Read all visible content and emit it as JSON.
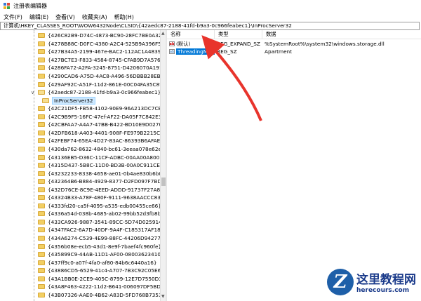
{
  "window": {
    "title": "注册表编辑器"
  },
  "menu": [
    "文件(F)",
    "编辑(E)",
    "查看(V)",
    "收藏夹(A)",
    "帮助(H)"
  ],
  "address": "计算机\\HKEY_CLASSES_ROOT\\WOW6432Node\\CLSID\\{42aedc87-2188-41fd-b9a3-0c966feabec1}\\InProcServer32",
  "tree": {
    "items_before": [
      "{426C82B9-D74C-4873-BC90-28FC7BE0A32A}",
      "{4278B88C-D0FC-4380-A2C4-525B9A396F5B}",
      "{427B34A5-2199-467e-BAC2-112AC1A48391}",
      "{427BC7E3-F833-4584-8745-CFAB9D7A5761}",
      "{4286FA72-A2FA-3245-8751-D4206070A191}",
      "{4290CAD6-A75D-4AC8-A496-56DBBB28EB88}",
      "{429AF92C-A51F-11d2-861E-00C04FA35C89}"
    ],
    "expanded": "{42aedc87-2188-41fd-b9a3-0c966feabec1}",
    "selected": "InProcServer32",
    "items_after": [
      "{42C21DF5-FB58-4102-90E9-96A213DC7CE8}",
      "{42C9B9F5-16FC-47ef-AF22-DA05F7C842E3}",
      "{42CBFAA7-A4A7-47BB-B422-BD10E9D02700}",
      "{42DFB618-A403-4401-908F-FE979B2215C8}",
      "{42FEBF74-65EA-4D27-83AC-86393B6AFAE1}",
      "{430da762-8632-4840-bc61-3eeaa078e62e}",
      "{43136EB5-D36C-11CF-ADBC-00AA00A80033}",
      "{4315D437-5B8C-11D0-BD3B-00A0C911CE86}",
      "{43232233-8338-4658-ae01-0b4ae830b6b0}",
      "{432364B6-B884-4929-8377-D2FD097F7BD3}",
      "{432D76CE-8C9E-4EED-ADDD-91737F27A8CB}",
      "{43324B33-A78F-480F-9111-9638AACCC832}",
      "{4333fd20-ca5f-4095-a535-edb00455ce66}",
      "{4336a54d-038b-4685-ab02-99bb52d3fb8b}",
      "{433CA926-9887-3541-89CC-5D74D0259144}",
      "{4347FAC2-6A7D-40DF-9A4F-C185317AF183}",
      "{434A6274-C539-4E99-88FC-44206D942775}",
      "{4356b08e-ecb5-43d1-8e9f-7baef4fc960fe}",
      "{435899C9-44AB-11D1-AF00-080036234103}",
      "{437ff9c0-a07f-4fa0-af80-84b6c6440a16}",
      "{43886CD5-6529-41c4-A707-7B3C92C05E68}",
      "{43A1BB0E-2CE9-405C-8799-12E7D7550D3F}",
      "{43A8F463-4222-11d2-B641-006097DF5BD4}",
      "{43B07326-AAE0-4B62-A83D-5FD768B7353C}"
    ]
  },
  "list": {
    "columns": [
      "名称",
      "类型",
      "数据"
    ],
    "rows": [
      {
        "name": "(默认)",
        "type": "REG_EXPAND_SZ",
        "data": "%SystemRoot%\\system32\\windows.storage.dll",
        "icon": "ab"
      },
      {
        "name": "ThreadingMod...",
        "type": "REG_SZ",
        "data": "Apartment",
        "icon": "ab"
      }
    ]
  },
  "watermark": {
    "logo": "Z",
    "cn": "这里教程网",
    "url": "herecours.com"
  },
  "colors": {
    "selection": "#0078d7",
    "arrow": "#e8342c",
    "folder": "#f2cf63"
  }
}
